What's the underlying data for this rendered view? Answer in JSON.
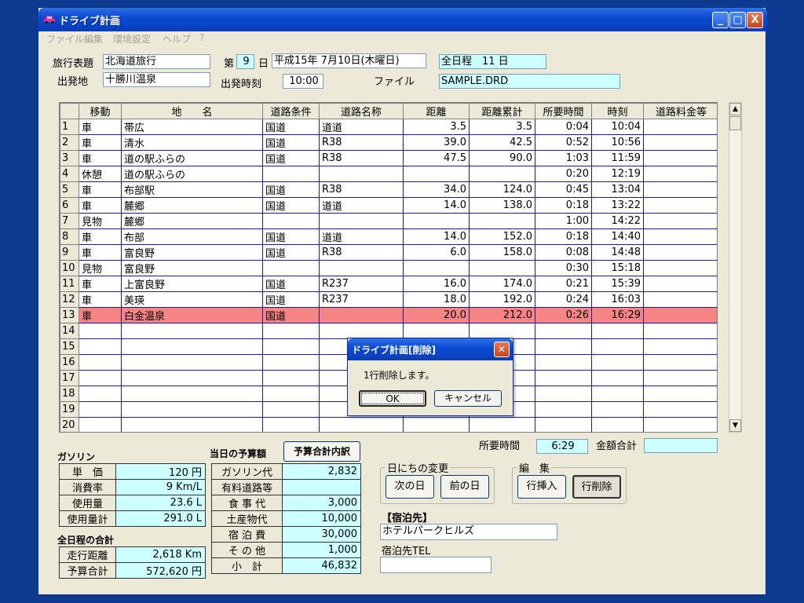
{
  "window": {
    "title": "ドライブ計画",
    "min_glyph": "_",
    "max_glyph": "□",
    "close_glyph": "X"
  },
  "menu": [
    "ファイル",
    "編集",
    "環境設定",
    "ヘルプ",
    "?"
  ],
  "header": {
    "travel_title_label": "旅行表題",
    "travel_title_value": "北海道旅行",
    "departure_label": "出発地",
    "departure_value": "十勝川温泉",
    "day_label_prefix": "第",
    "day_value": "9",
    "day_label_suffix": "日",
    "date_value": "平成15年 7月10日(木曜日)",
    "departure_time_label": "出発時刻",
    "departure_time_value": "10:00",
    "file_label": "ファイル",
    "file_value": "SAMPLE.DRD",
    "total_days_value": "全日程　11 日"
  },
  "grid": {
    "columns": [
      "",
      "移動",
      "地　　名",
      "道路条件",
      "道路名称",
      "距離",
      "距離累計",
      "所要時間",
      "時刻",
      "道路料金等"
    ],
    "rows": [
      [
        "1",
        "車",
        "帯広",
        "国道",
        "道道",
        "3.5",
        "3.5",
        "0:04",
        "10:04",
        ""
      ],
      [
        "2",
        "車",
        "清水",
        "国道",
        "R38",
        "39.0",
        "42.5",
        "0:52",
        "10:56",
        ""
      ],
      [
        "3",
        "車",
        "道の駅ふらの",
        "国道",
        "R38",
        "47.5",
        "90.0",
        "1:03",
        "11:59",
        ""
      ],
      [
        "4",
        "休憩",
        "道の駅ふらの",
        "",
        "",
        "",
        "",
        "0:20",
        "12:19",
        ""
      ],
      [
        "5",
        "車",
        "布部駅",
        "国道",
        "R38",
        "34.0",
        "124.0",
        "0:45",
        "13:04",
        ""
      ],
      [
        "6",
        "車",
        "麓郷",
        "国道",
        "道道",
        "14.0",
        "138.0",
        "0:18",
        "13:22",
        ""
      ],
      [
        "7",
        "見物",
        "麓郷",
        "",
        "",
        "",
        "",
        "1:00",
        "14:22",
        ""
      ],
      [
        "8",
        "車",
        "布部",
        "国道",
        "道道",
        "14.0",
        "152.0",
        "0:18",
        "14:40",
        ""
      ],
      [
        "9",
        "車",
        "富良野",
        "国道",
        "R38",
        "6.0",
        "158.0",
        "0:08",
        "14:48",
        ""
      ],
      [
        "10",
        "見物",
        "富良野",
        "",
        "",
        "",
        "",
        "0:30",
        "15:18",
        ""
      ],
      [
        "11",
        "車",
        "上富良野",
        "国道",
        "R237",
        "16.0",
        "174.0",
        "0:21",
        "15:39",
        ""
      ],
      [
        "12",
        "車",
        "美瑛",
        "国道",
        "R237",
        "18.0",
        "192.0",
        "0:24",
        "16:03",
        ""
      ],
      [
        "13",
        "車",
        "白金温泉",
        "国道",
        "",
        "20.0",
        "212.0",
        "0:26",
        "16:29",
        ""
      ],
      [
        "14",
        "",
        "",
        "",
        "",
        "",
        "",
        "",
        "",
        ""
      ],
      [
        "15",
        "",
        "",
        "",
        "",
        "",
        "",
        "",
        "",
        ""
      ],
      [
        "16",
        "",
        "",
        "",
        "",
        "",
        "",
        "",
        "",
        ""
      ],
      [
        "17",
        "",
        "",
        "",
        "",
        "",
        "",
        "",
        "",
        ""
      ],
      [
        "18",
        "",
        "",
        "",
        "",
        "",
        "",
        "",
        "",
        ""
      ],
      [
        "19",
        "",
        "",
        "",
        "",
        "",
        "",
        "",
        "",
        ""
      ],
      [
        "20",
        "",
        "",
        "",
        "",
        "",
        "",
        "",
        "",
        ""
      ]
    ],
    "selected_row": "13"
  },
  "totals": {
    "time_label": "所要時間",
    "time_value": "6:29",
    "amount_label": "金額合計",
    "amount_value": ""
  },
  "gasoline": {
    "title": "ガソリン",
    "rows": [
      [
        "単　価",
        "120 円"
      ],
      [
        "消費率",
        "9 Km/L"
      ],
      [
        "使用量",
        "23.6 L"
      ],
      [
        "使用量計",
        "291.0 L"
      ]
    ]
  },
  "all_days": {
    "title": "全日程の合計",
    "rows": [
      [
        "走行距離",
        "2,618 Km"
      ],
      [
        "予算合計",
        "572,620 円"
      ]
    ]
  },
  "budget": {
    "title": "当日の予算額",
    "detail_button": "予算合計内訳",
    "rows": [
      [
        "ガソリン代",
        "2,832"
      ],
      [
        "有料道路等",
        ""
      ],
      [
        "食 事 代",
        "3,000"
      ],
      [
        "土産物代",
        "10,000"
      ],
      [
        "宿 泊 費",
        "30,000"
      ],
      [
        "そ の 他",
        "1,000"
      ],
      [
        "小　計",
        "46,832"
      ]
    ]
  },
  "day_change": {
    "legend": "日にちの変更",
    "next": "次の日",
    "prev": "前の日"
  },
  "edit": {
    "legend": "編　集",
    "insert": "行挿入",
    "delete": "行削除"
  },
  "lodging": {
    "title": "【宿泊先】",
    "name": "ホテルパークヒルズ",
    "tel_label": "宿泊先TEL",
    "tel_value": ""
  },
  "dialog": {
    "title": "ドライブ計画[削除]",
    "message": "1行削除します。",
    "ok": "OK",
    "cancel": "キャンセル"
  }
}
